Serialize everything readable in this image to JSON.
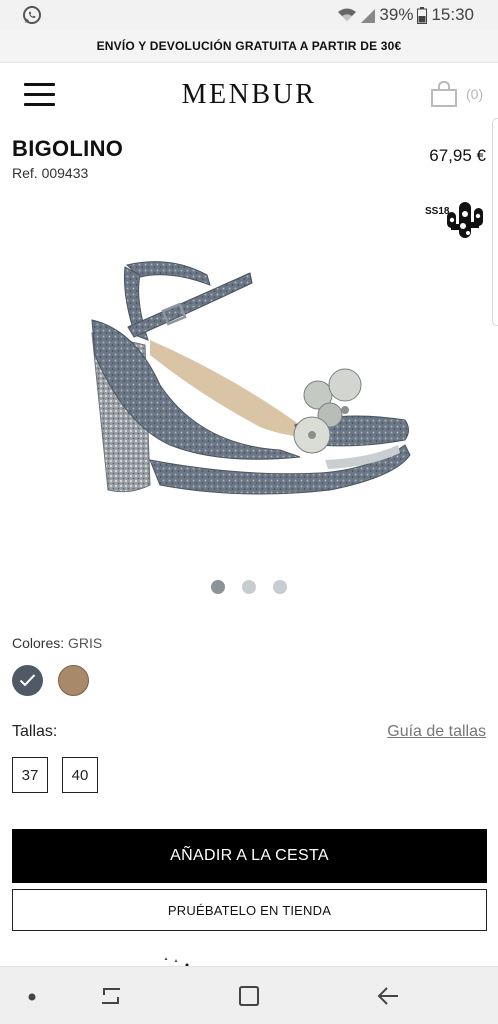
{
  "status_bar": {
    "battery": "39%",
    "time": "15:30",
    "icons": [
      "whatsapp-icon",
      "wifi-icon",
      "signal-icon",
      "battery-icon"
    ]
  },
  "promo": {
    "text": "ENVÍO Y DEVOLUCIÓN GRATUITA A PARTIR DE 30€"
  },
  "header": {
    "logo": "MENBUR",
    "cart_count": "(0)",
    "icons": [
      "menu-icon",
      "shopping-bag-icon"
    ]
  },
  "product": {
    "name": "BIGOLINO",
    "ref": "Ref. 009433",
    "price": "67,95 €",
    "season_badge": "SS18",
    "image_alt": "sandal-image",
    "carousel": {
      "slides": 3,
      "active": 1
    }
  },
  "colors": {
    "label": "Colores:",
    "selected": "GRIS",
    "swatches": [
      {
        "name": "gris",
        "hex": "#4f5a66",
        "selected": true
      },
      {
        "name": "marron",
        "hex": "#a88a6a",
        "selected": false
      }
    ]
  },
  "sizes": {
    "label": "Tallas:",
    "guide_link": "Guía de tallas",
    "options": [
      "37",
      "40"
    ]
  },
  "actions": {
    "add_to_cart": "AÑADIR A LA CESTA",
    "try_in_store": "PRUÉBATELO EN TIENDA"
  },
  "nav_bar": {
    "icons": [
      "dot-icon",
      "recents-icon",
      "home-icon",
      "back-icon"
    ]
  },
  "colors_theme": {
    "primary": "#000000",
    "background": "#ffffff",
    "muted": "#777777",
    "dot_active": "#8a9499",
    "dot_inactive": "#c7ccd0"
  }
}
